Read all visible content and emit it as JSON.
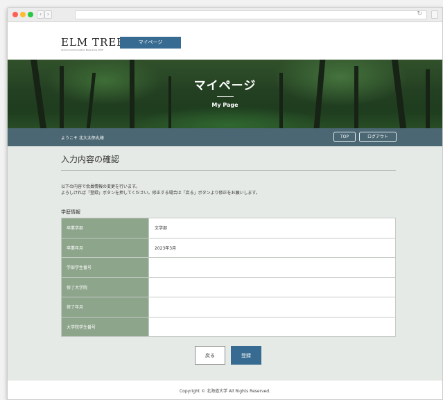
{
  "header": {
    "logo": "ELM TREE",
    "logo_sub": "Alumni Communication Base Since 2015",
    "mypage_button": "マイページ"
  },
  "hero": {
    "title": "マイページ",
    "subtitle": "My Page"
  },
  "userbar": {
    "welcome": "ようこそ 北大太郎丸様",
    "top_button": "TOP",
    "logout_button": "ログアウト"
  },
  "main": {
    "title": "入力内容の確認",
    "desc_line1": "以下の内容で会員情報の変更を行います。",
    "desc_line2": "よろしければ「登録」ボタンを押してください。修正する場合は「戻る」ボタンより修正をお願いします。",
    "section_label": "学歴情報",
    "rows": [
      {
        "label": "卒業学部",
        "value": "文学部"
      },
      {
        "label": "卒業年月",
        "value": "2023年3月"
      },
      {
        "label": "学部学生番号",
        "value": ""
      },
      {
        "label": "修了大学院",
        "value": ""
      },
      {
        "label": "修了年月",
        "value": ""
      },
      {
        "label": "大学院学生番号",
        "value": ""
      }
    ],
    "back_button": "戻る",
    "submit_button": "登録"
  },
  "footer": {
    "copyright": "Copyright © 北海道大学 All Rights Reserved."
  },
  "colors": {
    "accent": "#376b91",
    "userbar": "#4b6773",
    "table_header": "#8da58b",
    "content_bg": "#e6eae6"
  }
}
